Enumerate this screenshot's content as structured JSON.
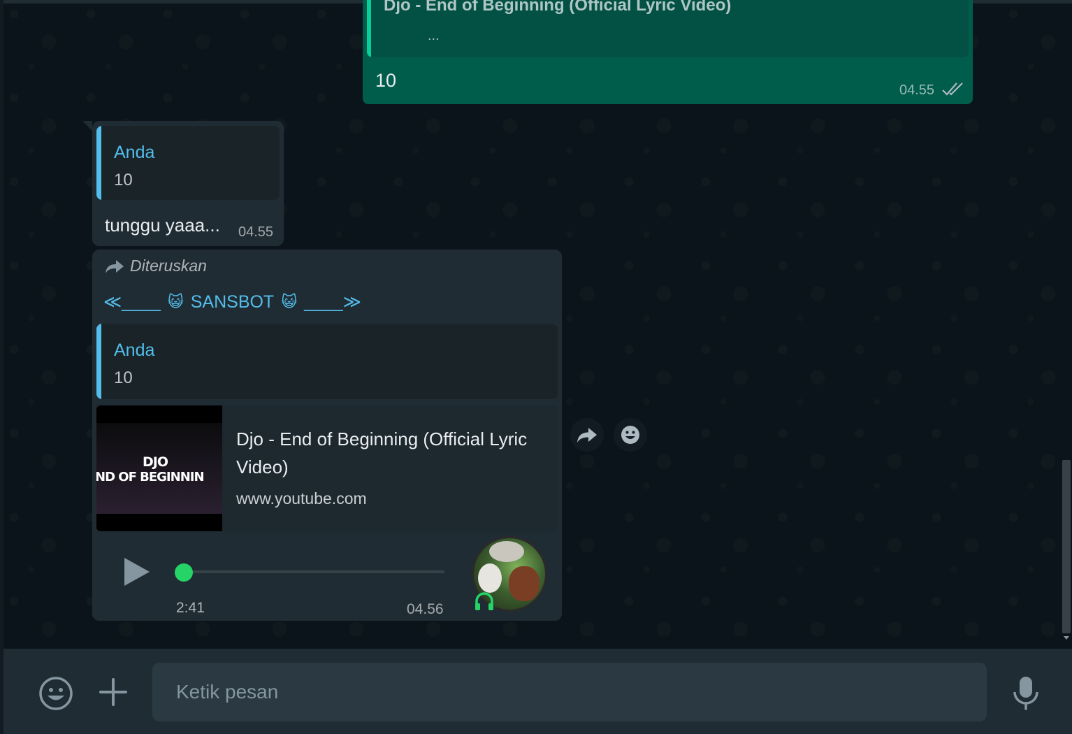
{
  "outgoing": {
    "quote_title": "Djo - End of Beginning (Official Lyric Video)",
    "quote_ellipsis": "...",
    "text": "10",
    "time": "04.55",
    "status_icon": "double-check-icon"
  },
  "message1": {
    "quote_name": "Anda",
    "quote_text": "10",
    "text": "tunggu yaaa...",
    "time": "04.55"
  },
  "message2": {
    "forwarded_label": "Diteruskan",
    "header_left": "≪____",
    "header_name": "SANSBOT",
    "header_right": "____≫",
    "header_emoji": "😺",
    "quote_name": "Anda",
    "quote_text": "10",
    "link": {
      "thumb_line1": "DJO",
      "thumb_line2": "ND OF BEGINNIN",
      "title": "Djo - End of Beginning (Official Lyric Video)",
      "url": "www.youtube.com"
    },
    "audio": {
      "duration": "2:41",
      "time": "04.56",
      "progress": 0
    }
  },
  "hover_actions": [
    "forward-icon",
    "emoji-icon"
  ],
  "composer": {
    "placeholder": "Ketik pesan"
  },
  "colors": {
    "bg": "#0b141a",
    "outgoing": "#005c4b",
    "incoming": "#202c33",
    "accent_blue": "#53bdeb",
    "accent_green": "#25d366"
  }
}
